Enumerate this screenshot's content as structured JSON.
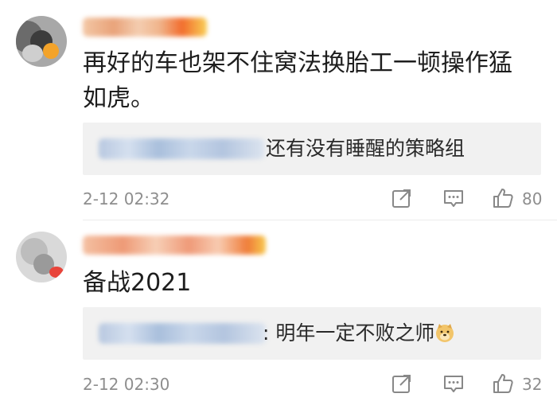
{
  "comments": [
    {
      "text": "再好的车也架不住窝法换胎工一顿操作猛如虎。",
      "reply_text": "还有没有睡醒的策略组",
      "time": "2-12 02:32",
      "likes": "80"
    },
    {
      "text": "备战2021",
      "reply_text": ": 明年一定不败之师",
      "time": "2-12 02:30",
      "likes": "32"
    }
  ],
  "icons": {
    "share": "share-icon",
    "reply": "comment-icon",
    "like": "thumbs-up-icon",
    "emoji": "doge-emoji"
  },
  "colors": {
    "meta_text": "#8e8e8e",
    "quote_bg": "#f1f1f1"
  }
}
